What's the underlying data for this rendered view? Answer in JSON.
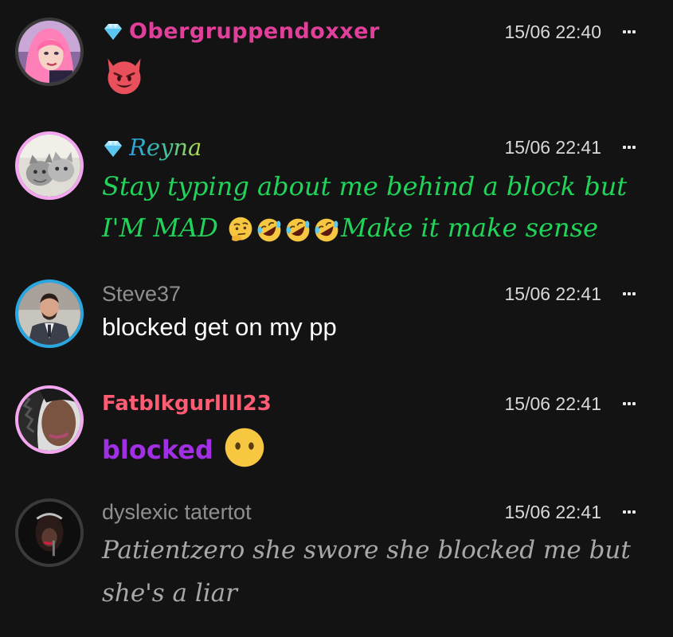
{
  "messages": [
    {
      "username": "Obergruppendoxxer",
      "badge": "diamond",
      "timestamp": "15/06 22:40",
      "text": "",
      "emoji": [
        "smiling-face-with-horns"
      ],
      "name_color": "#e0409a"
    },
    {
      "username": "Reyna",
      "badge": "diamond",
      "timestamp": "15/06 22:41",
      "text_line1": "Stay typing about me behind a block but",
      "text_line2_a": "I'M MAD",
      "text_line2_b": "Make it make sense",
      "emoji": [
        "thinking-face",
        "rolling-on-the-floor-laughing",
        "rolling-on-the-floor-laughing",
        "rolling-on-the-floor-laughing"
      ],
      "text_color": "#22d35a"
    },
    {
      "username": "Steve37",
      "timestamp": "15/06 22:41",
      "text": "blocked get on my pp",
      "text_color": "#ffffff"
    },
    {
      "username": "Fatblkgurllll23",
      "timestamp": "15/06 22:41",
      "text": "blocked",
      "emoji": [
        "face-without-mouth"
      ],
      "name_color": "#ff5c73",
      "text_color": "#a12fe3"
    },
    {
      "username": "dyslexic tatertot",
      "timestamp": "15/06 22:41",
      "text_line1": "Patientzero she swore she blocked me but",
      "text_line2": "she's a liar",
      "text_color": "#a8a8a8"
    }
  ],
  "colors": {
    "background": "#131313",
    "ring_pink": "#f4a7f0",
    "ring_blue": "#2aa6e0",
    "ring_dark": "#3a3a3a"
  }
}
